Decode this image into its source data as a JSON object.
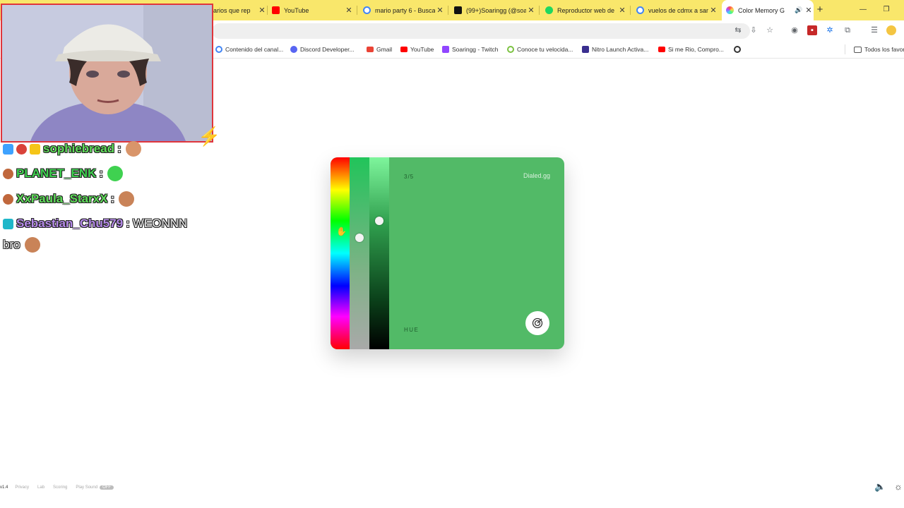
{
  "browser": {
    "tabs": [
      {
        "title": "arios que rep",
        "favicon": "google-icon"
      },
      {
        "title": "YouTube",
        "favicon": "youtube-icon"
      },
      {
        "title": "mario party 6 - Busca",
        "favicon": "google-icon"
      },
      {
        "title": "(99+)Soaringg (@soa",
        "favicon": "tiktok-icon"
      },
      {
        "title": "Reproductor web de",
        "favicon": "spotify-icon"
      },
      {
        "title": "vuelos de cdmx a san",
        "favicon": "google-icon"
      },
      {
        "title": "Color Memory G",
        "favicon": "color-wheel-icon",
        "active": true
      }
    ],
    "bookmarks": [
      {
        "label": "Contenido del canal...",
        "icon": "google-icon"
      },
      {
        "label": "Discord Developer...",
        "icon": "discord-icon"
      },
      {
        "label": "Gmail",
        "icon": "gmail-icon"
      },
      {
        "label": "YouTube",
        "icon": "youtube-icon"
      },
      {
        "label": "Soaringg - Twitch",
        "icon": "twitch-icon"
      },
      {
        "label": "Conoce tu velocida...",
        "icon": "speedtest-icon"
      },
      {
        "label": "Nitro Launch Activa...",
        "icon": "nitro-icon"
      },
      {
        "label": "Si me Rio, Compro...",
        "icon": "youtube-icon"
      },
      {
        "label": "Todos los favor",
        "icon": "folder-icon"
      }
    ]
  },
  "chat": [
    {
      "user": "sophiebread",
      "separator": ":",
      "message": "",
      "color": "#5fdc5a"
    },
    {
      "user": "PLANET_ENK",
      "separator": ":",
      "message": "",
      "color": "#3fd150"
    },
    {
      "user": "XxPaula_StarxX",
      "separator": ":",
      "message": "",
      "color": "#5fdc5a"
    },
    {
      "user": "Sebastian_Chu579",
      "separator": ":",
      "message": "WEONNN",
      "color": "#b58ae8"
    },
    {
      "user": "",
      "separator": "",
      "message": "bro",
      "color": "#f0f0f0"
    }
  ],
  "game": {
    "round": "3/5",
    "brand": "Dialed.gg",
    "mode_label": "HUE",
    "current_color": "#52ba67",
    "submit_icon": "target-icon"
  },
  "footer": {
    "version": "v1.4",
    "links": [
      "Privacy",
      "Lab",
      "Scoring",
      "Play Sound"
    ],
    "toggle": "OFF"
  }
}
